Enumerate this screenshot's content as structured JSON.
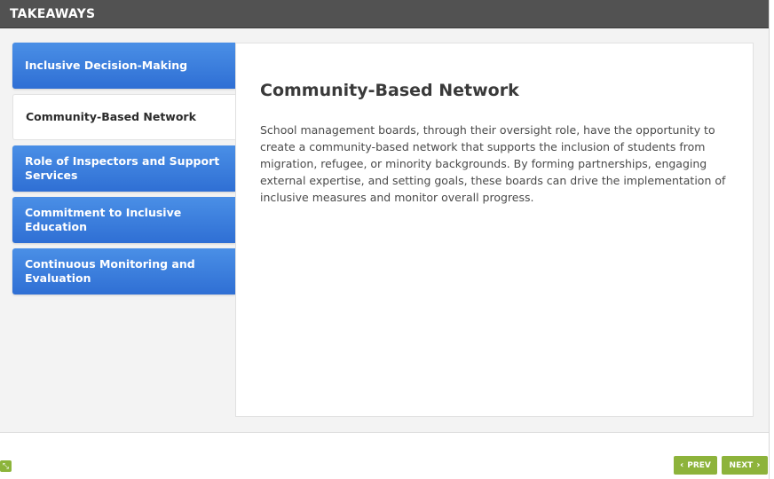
{
  "header": {
    "title": "TAKEAWAYS"
  },
  "tabs": [
    {
      "label": "Inclusive Decision-Making",
      "active": false
    },
    {
      "label": "Community-Based Network",
      "active": true
    },
    {
      "label": "Role of Inspectors and Support Services",
      "active": false
    },
    {
      "label": "Commitment to Inclusive Education",
      "active": false
    },
    {
      "label": "Continuous Monitoring and Evaluation",
      "active": false
    }
  ],
  "content": {
    "heading": "Community-Based Network",
    "body": "School management boards, through their oversight role, have the opportunity to create a community-based network that supports the inclusion of students from migration, refugee, or minority backgrounds. By forming partnerships, engaging external expertise, and setting goals, these boards can drive the implementation of inclusive measures and monitor overall progress."
  },
  "footer": {
    "prev_label": "PREV",
    "next_label": "NEXT",
    "prev_icon": "chevron-left-icon",
    "next_icon": "chevron-right-icon",
    "expand_icon": "expand-icon"
  },
  "colors": {
    "header_bg": "#525252",
    "tab_blue": "#3a7ddc",
    "nav_green": "#8db33b"
  }
}
